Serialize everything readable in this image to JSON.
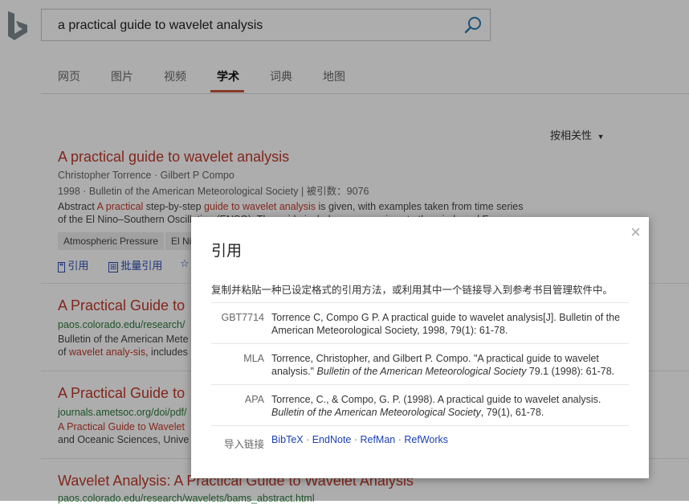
{
  "search": {
    "query": "a practical guide to wavelet analysis"
  },
  "tabs": [
    "网页",
    "图片",
    "视频",
    "学术",
    "词典",
    "地图"
  ],
  "active_tab": "学术",
  "sort_label": "按相关性",
  "results": [
    {
      "title": "A practical guide to wavelet analysis",
      "authors": "Christopher Torrence · Gilbert P Compo",
      "meta": "1998 · Bulletin of the American Meteorological Society  |  被引数：9076",
      "abs1_pre": "Abstract ",
      "abs1_hl1": "A practical",
      "abs1_mid": " step-by-step ",
      "abs1_hl2": "guide to wavelet analysis",
      "abs1_post": " is given, with examples taken from time series",
      "abs2": "of the El Nino–Southern Oscillation (ENSO). The guide includes a comparison to the windowed F",
      "chips": [
        "Atmospheric Pressure",
        "El Nino"
      ],
      "actions": {
        "cite": "引用",
        "batch": "批量引用"
      }
    },
    {
      "title": "A Practical Guide to",
      "url": "paos.colorado.edu/research/",
      "l1": "Bulletin of the American Mete",
      "l2_pre": "of ",
      "l2_hl": "wavelet analy-sis",
      "l2_post": ", includes"
    },
    {
      "title": "A Practical Guide to",
      "url": "journals.ametsoc.org/doi/pdf/",
      "l1": "A Practical Guide to Wavelet",
      "l2": "and Oceanic Sciences, Unive"
    },
    {
      "title": "Wavelet Analysis: A Practical Guide to Wavelet Analysis",
      "url": "paos.colorado.edu/research/wavelets/bams_abstract.html"
    }
  ],
  "modal": {
    "title": "引用",
    "close": "×",
    "description": "复制并粘贴一种已设定格式的引用方法，或利用其中一个链接导入到参考书目管理软件中。",
    "citations": [
      {
        "format": "GBT7714",
        "plain1": "Torrence C, Compo G P. A practical guide to wavelet analysis[J]. Bulletin of the American Meteorological Society, 1998, 79(1): 61-78."
      },
      {
        "format": "MLA",
        "plain1": "Torrence, Christopher, and Gilbert P. Compo. \"A practical guide to wavelet analysis.\" ",
        "italic": "Bulletin of the American Meteorological Society",
        "plain2": " 79.1 (1998): 61-78."
      },
      {
        "format": "APA",
        "plain1": "Torrence, C., & Compo, G. P. (1998). A practical guide to wavelet analysis. ",
        "italic": "Bulletin of the American Meteorological Society",
        "plain2": ", 79(1), 61-78."
      }
    ],
    "import_label": "导入链接",
    "links": [
      "BibTeX",
      "EndNote",
      "RefMan",
      "RefWorks"
    ]
  }
}
